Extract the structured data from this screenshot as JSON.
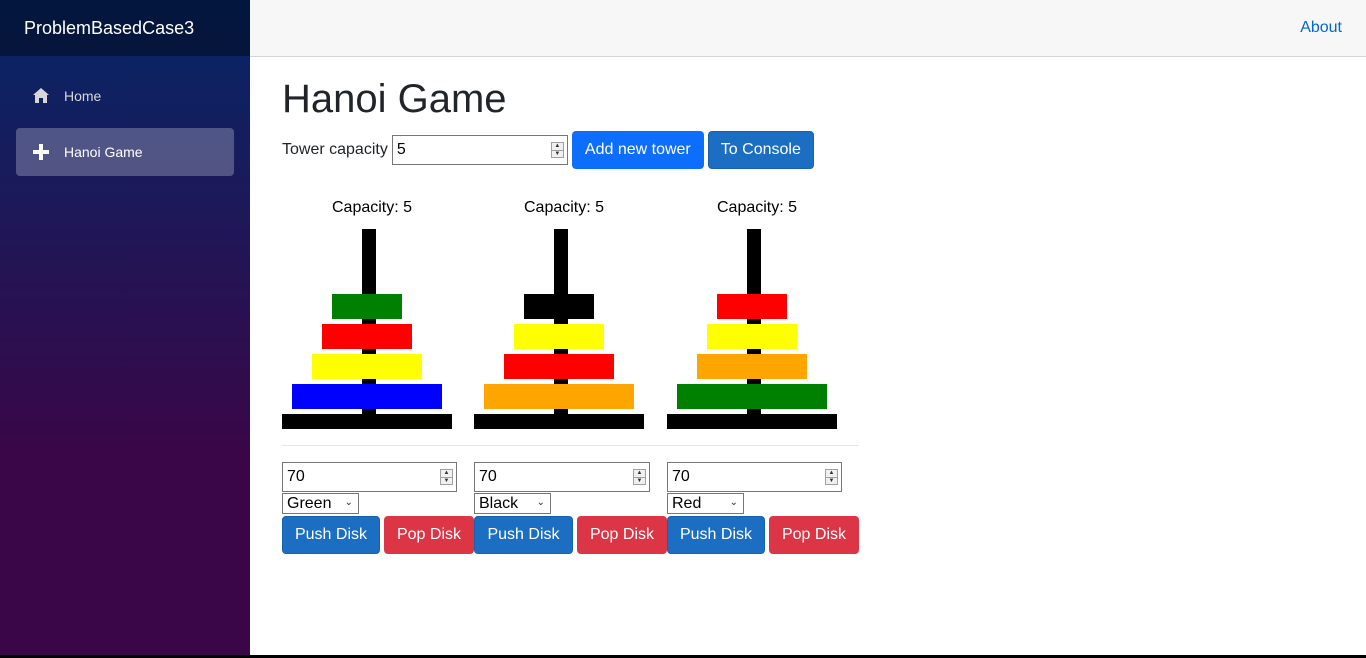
{
  "sidebar": {
    "brand": "ProblemBasedCase3",
    "items": [
      {
        "label": "Home",
        "icon": "home-icon"
      },
      {
        "label": "Hanoi Game",
        "icon": "plus-icon"
      }
    ]
  },
  "topbar": {
    "about": "About"
  },
  "page": {
    "title": "Hanoi Game"
  },
  "controls": {
    "capacity_label": "Tower capacity",
    "capacity_value": "5",
    "add_tower": "Add new tower",
    "to_console": "To Console"
  },
  "towers": [
    {
      "capacity_text": "Capacity: 5",
      "disks": [
        {
          "color": "#008000",
          "size": 70
        },
        {
          "color": "#ff0000",
          "size": 90
        },
        {
          "color": "#ffff00",
          "size": 110
        },
        {
          "color": "#0000ff",
          "size": 150
        }
      ],
      "size_value": "70",
      "color_value": "Green",
      "push": "Push Disk",
      "pop": "Pop Disk"
    },
    {
      "capacity_text": "Capacity: 5",
      "disks": [
        {
          "color": "#000000",
          "size": 70
        },
        {
          "color": "#ffff00",
          "size": 90
        },
        {
          "color": "#ff0000",
          "size": 110
        },
        {
          "color": "#ffa500",
          "size": 150
        }
      ],
      "size_value": "70",
      "color_value": "Black",
      "push": "Push Disk",
      "pop": "Pop Disk"
    },
    {
      "capacity_text": "Capacity: 5",
      "disks": [
        {
          "color": "#ff0000",
          "size": 70
        },
        {
          "color": "#ffff00",
          "size": 90
        },
        {
          "color": "#ffa500",
          "size": 110
        },
        {
          "color": "#008000",
          "size": 150
        }
      ],
      "size_value": "70",
      "color_value": "Red",
      "push": "Push Disk",
      "pop": "Pop Disk"
    }
  ]
}
